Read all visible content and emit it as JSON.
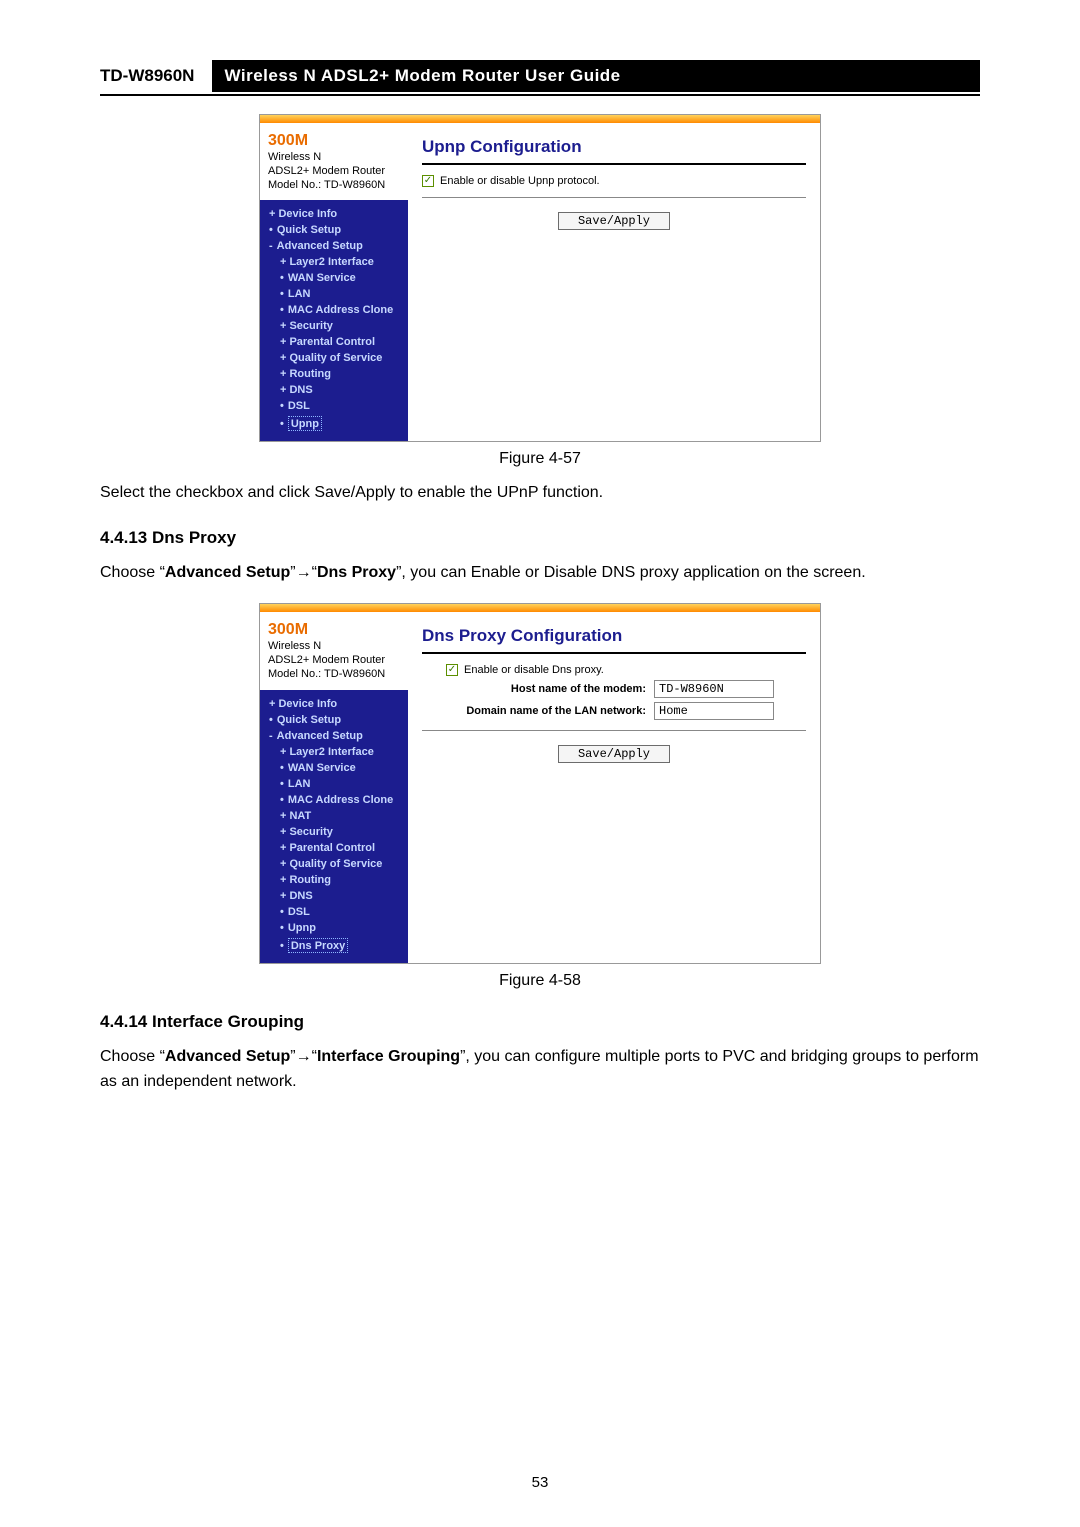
{
  "header": {
    "model": "TD-W8960N",
    "title": "Wireless  N  ADSL2+  Modem  Router  User  Guide"
  },
  "figure1": {
    "brand_big": "300M",
    "brand_l2": "Wireless N",
    "brand_l3": "ADSL2+ Modem Router",
    "brand_l4": "Model No.: TD-W8960N",
    "nav": {
      "device_info": "Device Info",
      "quick_setup": "Quick Setup",
      "advanced_setup": "Advanced Setup",
      "layer2": "Layer2 Interface",
      "wan": "WAN Service",
      "lan": "LAN",
      "mac": "MAC Address Clone",
      "security": "Security",
      "parental": "Parental Control",
      "qos": "Quality of Service",
      "routing": "Routing",
      "dns": "DNS",
      "dsl": "DSL",
      "upnp": "Upnp"
    },
    "main_title": "Upnp Configuration",
    "checkbox_label": "Enable or disable Upnp protocol.",
    "save_label": "Save/Apply",
    "caption": "Figure 4-57"
  },
  "para1": "Select the checkbox and click Save/Apply to enable the UPnP function.",
  "section1": "4.4.13 Dns Proxy",
  "para2": {
    "pre": "Choose “",
    "b1": "Advanced Setup",
    "mid1": "”",
    "arrow": "→",
    "mid2": "“",
    "b2": "Dns Proxy",
    "post": "”, you can Enable or Disable DNS proxy application on the screen."
  },
  "figure2": {
    "brand_big": "300M",
    "brand_l2": "Wireless N",
    "brand_l3": "ADSL2+ Modem Router",
    "brand_l4": "Model No.: TD-W8960N",
    "nav": {
      "device_info": "Device Info",
      "quick_setup": "Quick Setup",
      "advanced_setup": "Advanced Setup",
      "layer2": "Layer2 Interface",
      "wan": "WAN Service",
      "lan": "LAN",
      "mac": "MAC Address Clone",
      "nat": "NAT",
      "security": "Security",
      "parental": "Parental Control",
      "qos": "Quality of Service",
      "routing": "Routing",
      "dns": "DNS",
      "dsl": "DSL",
      "upnp": "Upnp",
      "dnsproxy": "Dns Proxy"
    },
    "main_title": "Dns Proxy Configuration",
    "checkbox_label": "Enable or disable Dns proxy.",
    "host_label": "Host name of the modem:",
    "host_value": "TD-W8960N",
    "domain_label": "Domain name of the LAN network:",
    "domain_value": "Home",
    "save_label": "Save/Apply",
    "caption": "Figure 4-58"
  },
  "section2": "4.4.14 Interface Grouping",
  "para3": {
    "pre": "Choose “",
    "b1": "Advanced Setup",
    "mid1": "”",
    "arrow": "→",
    "mid2": "“",
    "b2": "Interface Grouping",
    "post": "”, you can configure multiple ports to PVC and bridging groups to perform as an independent network."
  },
  "page_number": "53"
}
